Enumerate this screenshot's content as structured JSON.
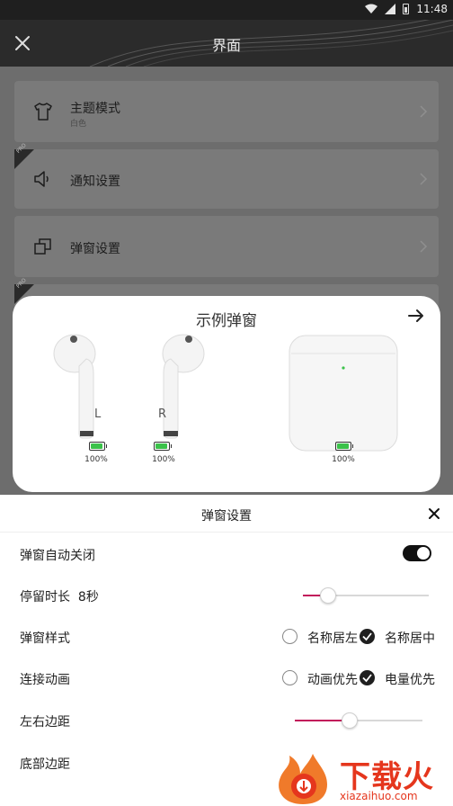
{
  "status_bar": {
    "time": "11:48"
  },
  "header": {
    "title": "界面",
    "close_icon": "close-icon"
  },
  "settings": {
    "items": [
      {
        "label": "主题模式",
        "sub": "白色",
        "icon": "tshirt-icon",
        "pro": false
      },
      {
        "label": "通知设置",
        "sub": "",
        "icon": "speaker-icon",
        "pro": true
      },
      {
        "label": "弹窗设置",
        "sub": "",
        "icon": "window-copy-icon",
        "pro": false
      }
    ],
    "pro_badge": "PRO"
  },
  "popup": {
    "title": "示例弹窗",
    "left": {
      "letter": "L",
      "battery": "100%",
      "level": 1.0
    },
    "right": {
      "letter": "R",
      "battery": "100%",
      "level": 1.0
    },
    "case": {
      "battery": "100%",
      "level": 1.0
    },
    "battery_color": "#3bc24a"
  },
  "sheet": {
    "title": "弹窗设置",
    "auto_close": {
      "label": "弹窗自动关闭",
      "on": true
    },
    "stay_time": {
      "label": "停留时长",
      "value": "8秒",
      "level": 0.2
    },
    "popup_style": {
      "label": "弹窗样式",
      "options": [
        "名称居左",
        "名称居中"
      ],
      "selected": 1
    },
    "connect_anim": {
      "label": "连接动画",
      "options": [
        "动画优先",
        "电量优先"
      ],
      "selected": 1
    },
    "side_margin": {
      "label": "左右边距",
      "level": 0.43
    },
    "bottom_margin": {
      "label": "底部边距"
    }
  },
  "accent_color": "#c2185b",
  "watermark": {
    "text": "下载火",
    "sub": "xiazaihuo.com"
  }
}
